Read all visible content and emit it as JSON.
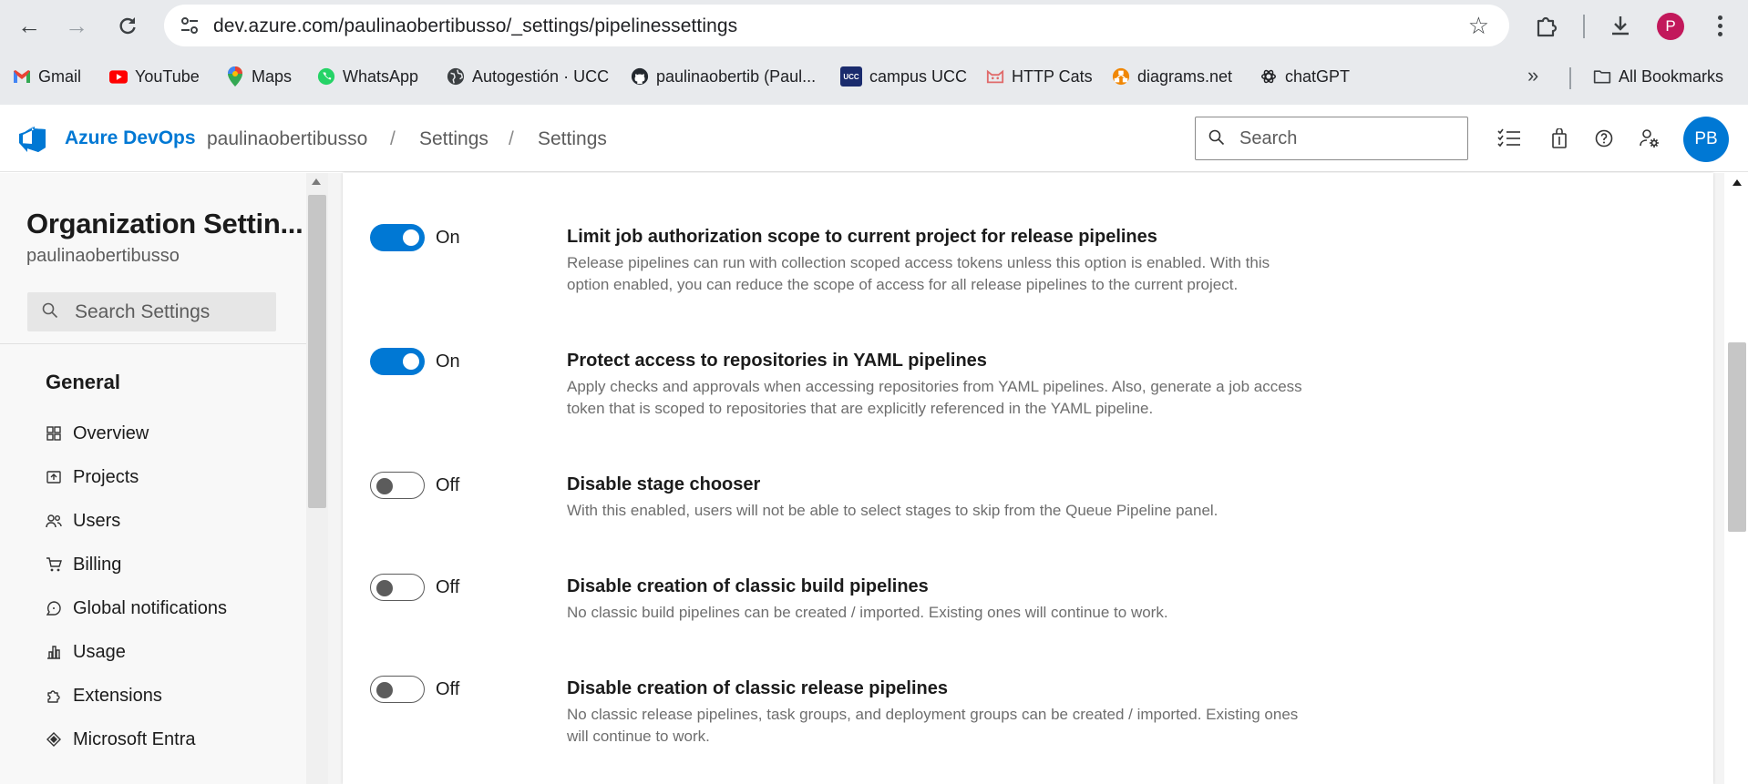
{
  "browser": {
    "url": "dev.azure.com/paulinaobertibusso/_settings/pipelinessettings",
    "profile_initial": "P",
    "bookmarks": [
      {
        "label": "Gmail",
        "icon": "gmail-icon"
      },
      {
        "label": "YouTube",
        "icon": "youtube-icon"
      },
      {
        "label": "Maps",
        "icon": "maps-icon"
      },
      {
        "label": "WhatsApp",
        "icon": "whatsapp-icon"
      },
      {
        "label": "Autogestión · UCC",
        "icon": "globe-icon"
      },
      {
        "label": "paulinaobertib (Paul...",
        "icon": "github-icon"
      },
      {
        "label": "campus UCC",
        "icon": "ucc-icon",
        "icon_text": "UCC"
      },
      {
        "label": "HTTP Cats",
        "icon": "http-cats-icon"
      },
      {
        "label": "diagrams.net",
        "icon": "diagrams-icon"
      },
      {
        "label": "chatGPT",
        "icon": "chatgpt-icon"
      }
    ],
    "all_bookmarks_label": "All Bookmarks"
  },
  "header": {
    "brand": "Azure DevOps",
    "breadcrumbs": [
      "paulinaobertibusso",
      "Settings",
      "Settings"
    ],
    "breadcrumb_separator": "/",
    "search_placeholder": "Search",
    "avatar_initials": "PB",
    "brand_color": "#0078d4"
  },
  "sidebar": {
    "title": "Organization Settin...",
    "subtitle": "paulinaobertibusso",
    "search_placeholder": "Search Settings",
    "group_title": "General",
    "items": [
      {
        "label": "Overview",
        "icon": "overview-icon"
      },
      {
        "label": "Projects",
        "icon": "projects-icon"
      },
      {
        "label": "Users",
        "icon": "users-icon"
      },
      {
        "label": "Billing",
        "icon": "billing-cart-icon"
      },
      {
        "label": "Global notifications",
        "icon": "notifications-icon"
      },
      {
        "label": "Usage",
        "icon": "usage-chart-icon"
      },
      {
        "label": "Extensions",
        "icon": "extensions-puzzle-icon"
      },
      {
        "label": "Microsoft Entra",
        "icon": "entra-icon"
      }
    ]
  },
  "settings": [
    {
      "on": true,
      "state_label": "On",
      "title": "Limit job authorization scope to current project for release pipelines",
      "description": "Release pipelines can run with collection scoped access tokens unless this option is enabled. With this option enabled, you can reduce the scope of access for all release pipelines to the current project."
    },
    {
      "on": true,
      "state_label": "On",
      "title": "Protect access to repositories in YAML pipelines",
      "description": "Apply checks and approvals when accessing repositories from YAML pipelines. Also, generate a job access token that is scoped to repositories that are explicitly referenced in the YAML pipeline."
    },
    {
      "on": false,
      "state_label": "Off",
      "title": "Disable stage chooser",
      "description": "With this enabled, users will not be able to select stages to skip from the Queue Pipeline panel."
    },
    {
      "on": false,
      "state_label": "Off",
      "title": "Disable creation of classic build pipelines",
      "description": "No classic build pipelines can be created / imported. Existing ones will continue to work."
    },
    {
      "on": false,
      "state_label": "Off",
      "title": "Disable creation of classic release pipelines",
      "description": "No classic release pipelines, task groups, and deployment groups can be created / imported. Existing ones will continue to work."
    }
  ]
}
